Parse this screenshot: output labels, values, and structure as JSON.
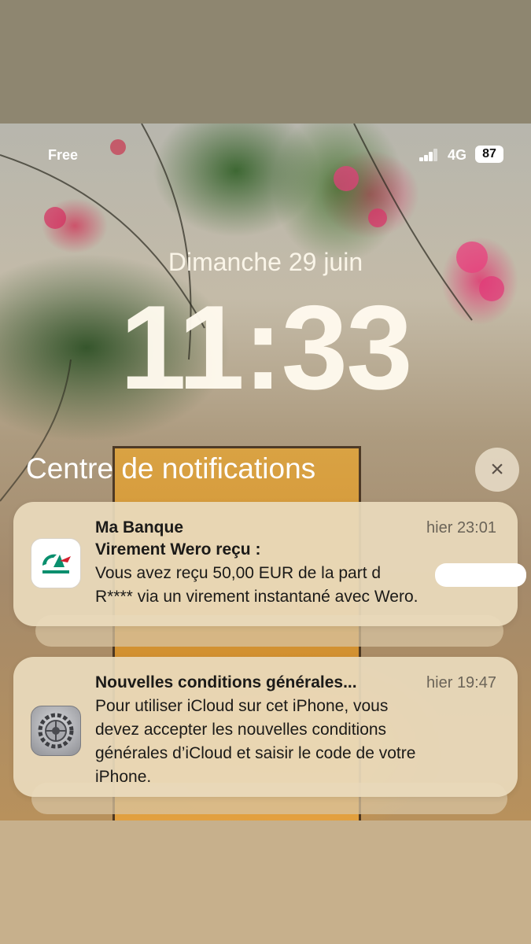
{
  "status_bar": {
    "carrier": "Free",
    "network": "4G",
    "battery": "87",
    "signal_bars": 4
  },
  "lock_screen": {
    "date": "Dimanche 29 juin",
    "time": "11:33"
  },
  "notification_center": {
    "title": "Centre de notifications",
    "close_icon": "×"
  },
  "notifications": [
    {
      "icon": "credit-agricole-icon",
      "app": "Ma Banque",
      "time": "hier 23:01",
      "title": "Virement Wero reçu :",
      "body_line1": "Vous avez reçu 50,00 EUR de la part d",
      "body_line2": "R**** via un virement instantané avec Wero."
    },
    {
      "icon": "settings-gear-icon",
      "title": "Nouvelles conditions générales...",
      "time": "hier 19:47",
      "body_line1": "Pour utiliser iCloud sur cet iPhone, vous",
      "body_line2": "devez accepter les nouvelles conditions",
      "body_line3": "générales d’iCloud et saisir le code de votre",
      "body_line4": "iPhone."
    }
  ],
  "colors": {
    "ca_green": "#0a8f6e",
    "ca_red": "#d4202f",
    "card_bg": "#eadabc"
  }
}
